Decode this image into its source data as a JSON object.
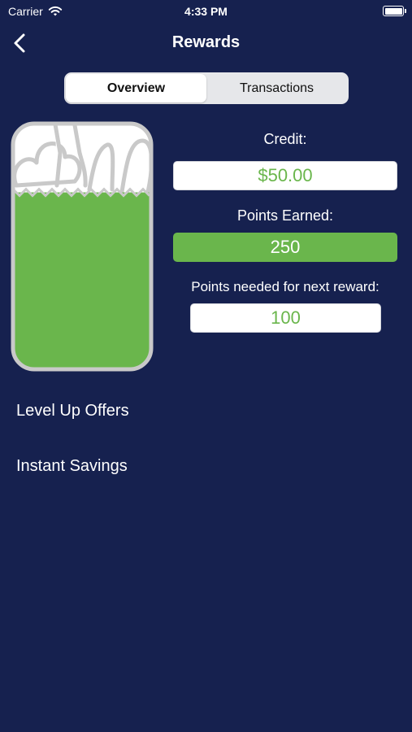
{
  "status_bar": {
    "carrier": "Carrier",
    "time": "4:33 PM",
    "wifi_icon": "wifi-icon",
    "battery_icon": "battery-icon"
  },
  "nav": {
    "title": "Rewards",
    "back_icon": "chevron-left-icon"
  },
  "tabs": [
    {
      "label": "Overview",
      "selected": true
    },
    {
      "label": "Transactions",
      "selected": false
    }
  ],
  "rewards": {
    "credit_label": "Credit:",
    "credit_value": "$50.00",
    "points_label": "Points Earned:",
    "points_value": "250",
    "needed_label": "Points needed for next reward:",
    "needed_value": "100",
    "bag_fill_fraction": 0.72
  },
  "list": [
    {
      "label": "Level Up Offers"
    },
    {
      "label": "Instant Savings"
    }
  ],
  "colors": {
    "background": "#16214f",
    "accent_green": "#6ab64c",
    "bag_outline": "#c9c9c9"
  }
}
